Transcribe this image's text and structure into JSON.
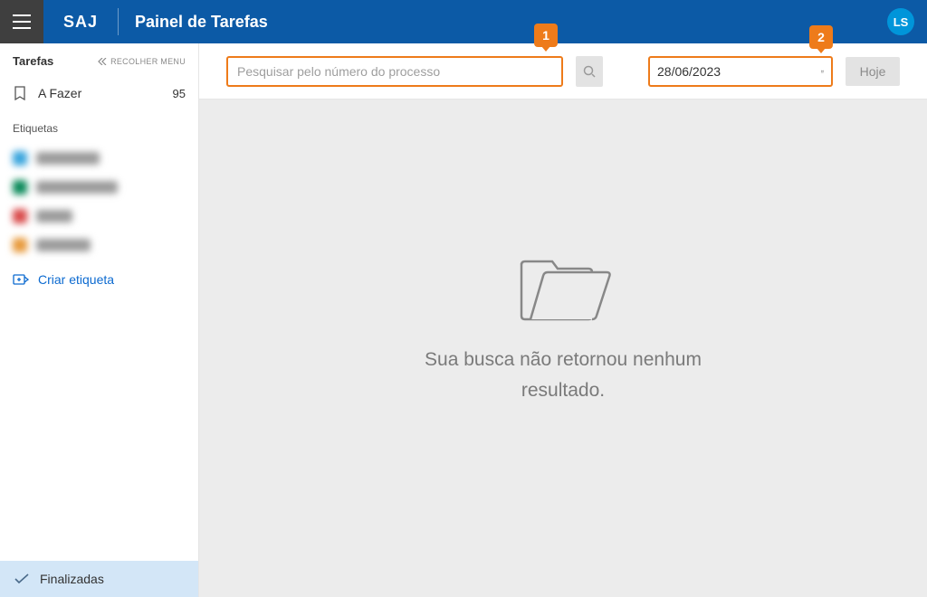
{
  "header": {
    "brand": "SAJ",
    "title": "Painel de Tarefas",
    "avatar_initials": "LS"
  },
  "sidebar": {
    "section_title": "Tarefas",
    "collapse_label": "RECOLHER MENU",
    "todo": {
      "label": "A Fazer",
      "count": "95"
    },
    "tags_section_label": "Etiquetas",
    "create_tag_label": "Criar etiqueta",
    "finalizadas_label": "Finalizadas"
  },
  "toolbar": {
    "search_placeholder": "Pesquisar pelo número do processo",
    "date_value": "28/06/2023",
    "hoje_label": "Hoje",
    "callout1": "1",
    "callout2": "2"
  },
  "empty": {
    "message": "Sua busca não retornou nenhum resultado."
  },
  "colors": {
    "tag1": "#3aa5dd",
    "tag2": "#0b8a5a",
    "tag3": "#d94b4b",
    "tag4": "#e89a3c"
  }
}
